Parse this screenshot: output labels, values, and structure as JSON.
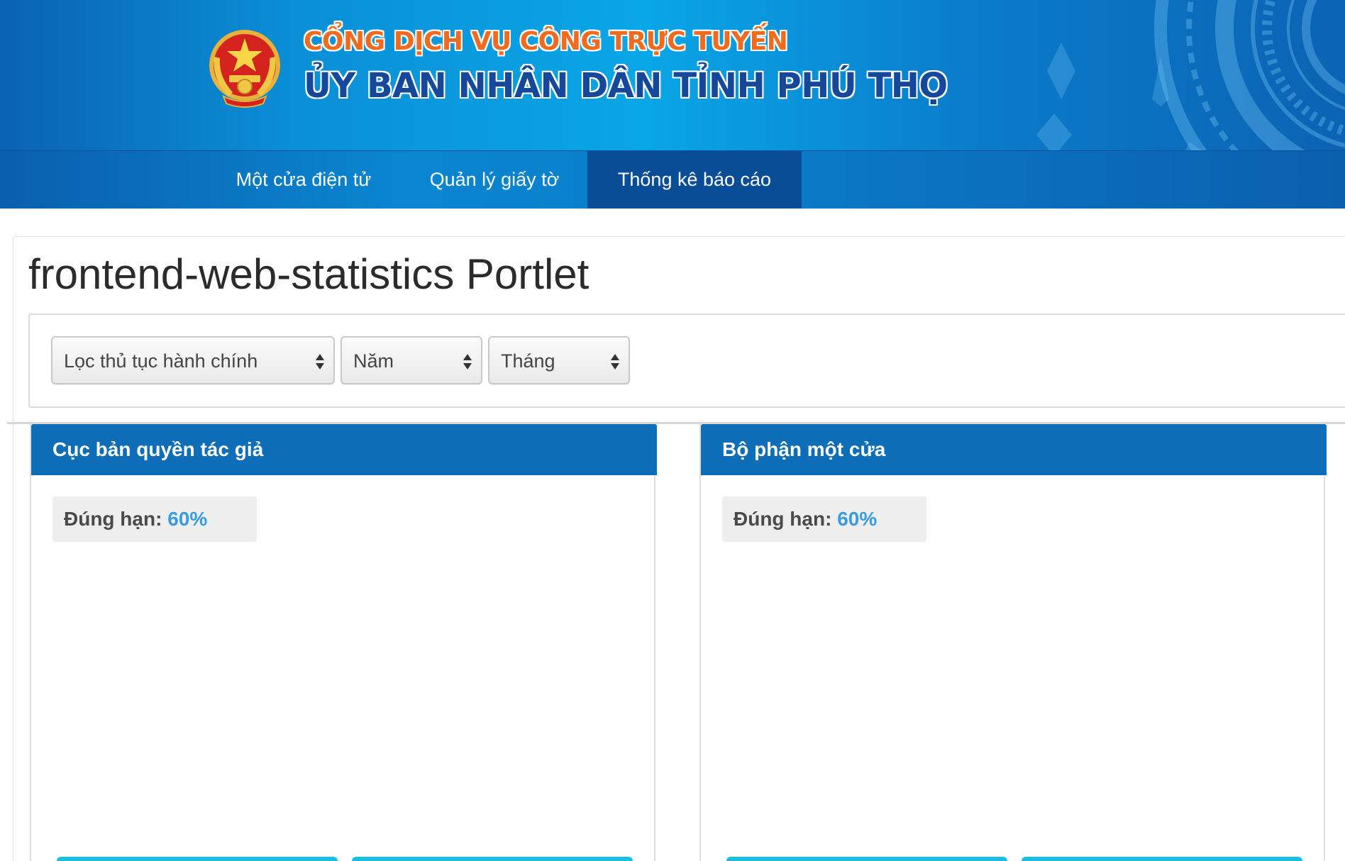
{
  "header": {
    "line1": "CỔNG DỊCH VỤ CÔNG TRỰC TUYẾN",
    "line2": "ỦY BAN NHÂN DÂN TỈNH PHÚ THỌ",
    "emblem_icon": "national-emblem-icon"
  },
  "nav": {
    "items": [
      {
        "label": "Một cửa điện tử",
        "active": false
      },
      {
        "label": "Quản lý giấy tờ",
        "active": false
      },
      {
        "label": "Thống kê báo cáo",
        "active": true
      }
    ]
  },
  "portlet": {
    "title": "frontend-web-statistics Portlet"
  },
  "filters": {
    "procedure": "Lọc thủ tục hành chính",
    "year": "Năm",
    "month": "Tháng"
  },
  "panels": [
    {
      "title": "Cục bản quyền tác giả",
      "stat_label": "Đúng hạn:",
      "stat_value": "60%"
    },
    {
      "title": "Bộ phận một cửa",
      "stat_label": "Đúng hạn:",
      "stat_value": "60%"
    }
  ],
  "colors": {
    "header_accent_orange": "#f26a1d",
    "header_title_blue": "#15489a",
    "nav_active": "#0a4d97",
    "panel_header": "#0e6db7",
    "stat_value": "#3a9be0"
  }
}
